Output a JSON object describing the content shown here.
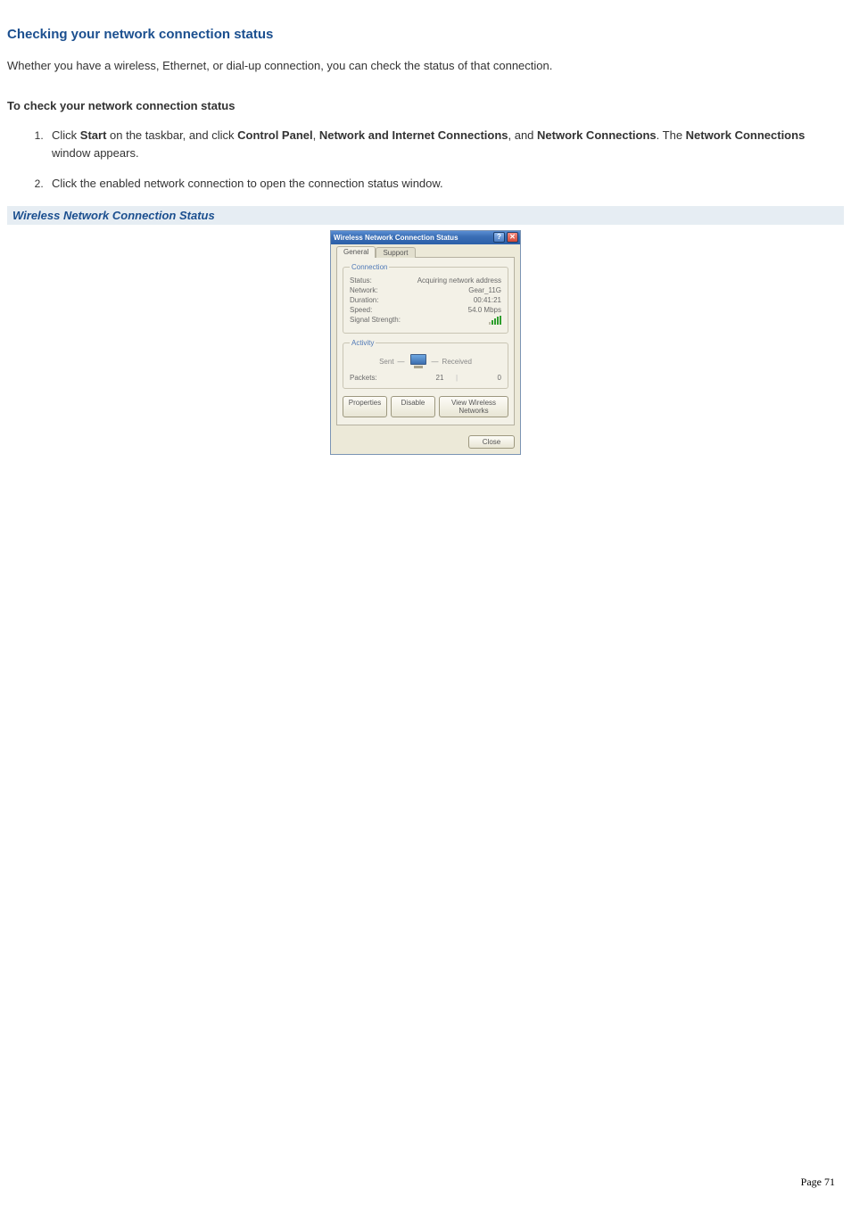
{
  "heading": "Checking your network connection status",
  "intro": "Whether you have a wireless, Ethernet, or dial-up connection, you can check the status of that connection.",
  "subheading": "To check your network connection status",
  "steps": {
    "s1_pre": "Click ",
    "s1_b1": "Start",
    "s1_mid1": " on the taskbar, and click ",
    "s1_b2": "Control Panel",
    "s1_mid2": ", ",
    "s1_b3": "Network and Internet Connections",
    "s1_mid3": ", and ",
    "s1_b4": "Network Connections",
    "s1_mid4": ". The ",
    "s1_b5": "Network Connections",
    "s1_post": " window appears.",
    "s2": "Click the enabled network connection to open the connection status window."
  },
  "caption": "Wireless Network Connection Status",
  "dialog": {
    "title": "Wireless Network Connection Status",
    "tabs": {
      "general": "General",
      "support": "Support"
    },
    "groups": {
      "connection": "Connection",
      "activity": "Activity"
    },
    "labels": {
      "status": "Status:",
      "network": "Network:",
      "duration": "Duration:",
      "speed": "Speed:",
      "signal": "Signal Strength:",
      "sent": "Sent",
      "received": "Received",
      "packets": "Packets:"
    },
    "values": {
      "status": "Acquiring network address",
      "network": "Gear_11G",
      "duration": "00:41:21",
      "speed": "54.0 Mbps",
      "packets_sent": "21",
      "packets_recv": "0"
    },
    "buttons": {
      "properties": "Properties",
      "disable": "Disable",
      "view": "View Wireless Networks",
      "close": "Close"
    }
  },
  "footer": {
    "label": "Page ",
    "num": "71"
  }
}
